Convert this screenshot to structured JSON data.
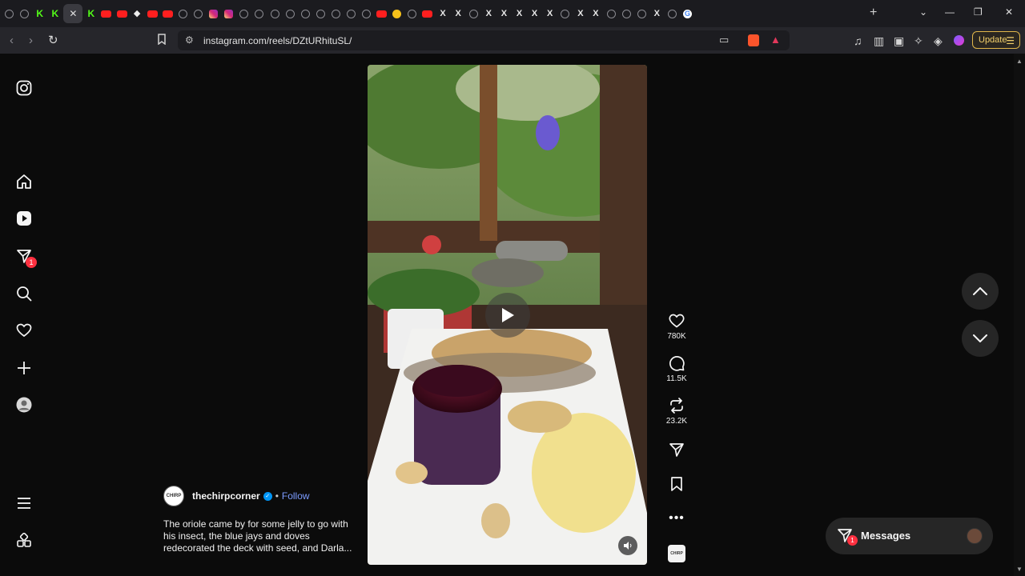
{
  "browser": {
    "tabs": [
      "globe",
      "globe",
      "kick",
      "kick",
      "close",
      "kick",
      "yt",
      "yt",
      "diamond",
      "yt",
      "yt",
      "globe",
      "globe",
      "ig",
      "ig",
      "globe",
      "globe",
      "globe",
      "globe",
      "globe",
      "globe",
      "globe",
      "globe",
      "globe",
      "yt",
      "emoji",
      "globe",
      "yt",
      "x",
      "x",
      "globe",
      "x",
      "x",
      "x",
      "x",
      "x",
      "globe",
      "x",
      "x",
      "globe",
      "globe",
      "globe",
      "x",
      "globe",
      "g"
    ],
    "url": "instagram.com/reels/DZtURhituSL/",
    "update_label": "Update"
  },
  "sidebar": {
    "notifications_badge": "1"
  },
  "reel": {
    "username": "thechirpcorner",
    "follow_label": "Follow",
    "separator": "•",
    "caption": "The oriole came by for some jelly to go with his insect, the blue jays and doves redecorated the deck with seed, and Darla...",
    "avatar_text": "CHIRP",
    "likes": "780K",
    "comments": "11.5K",
    "reposts": "23.2K",
    "audio_thumb_text": "CHIRP"
  },
  "messages": {
    "label": "Messages",
    "badge": "1"
  }
}
